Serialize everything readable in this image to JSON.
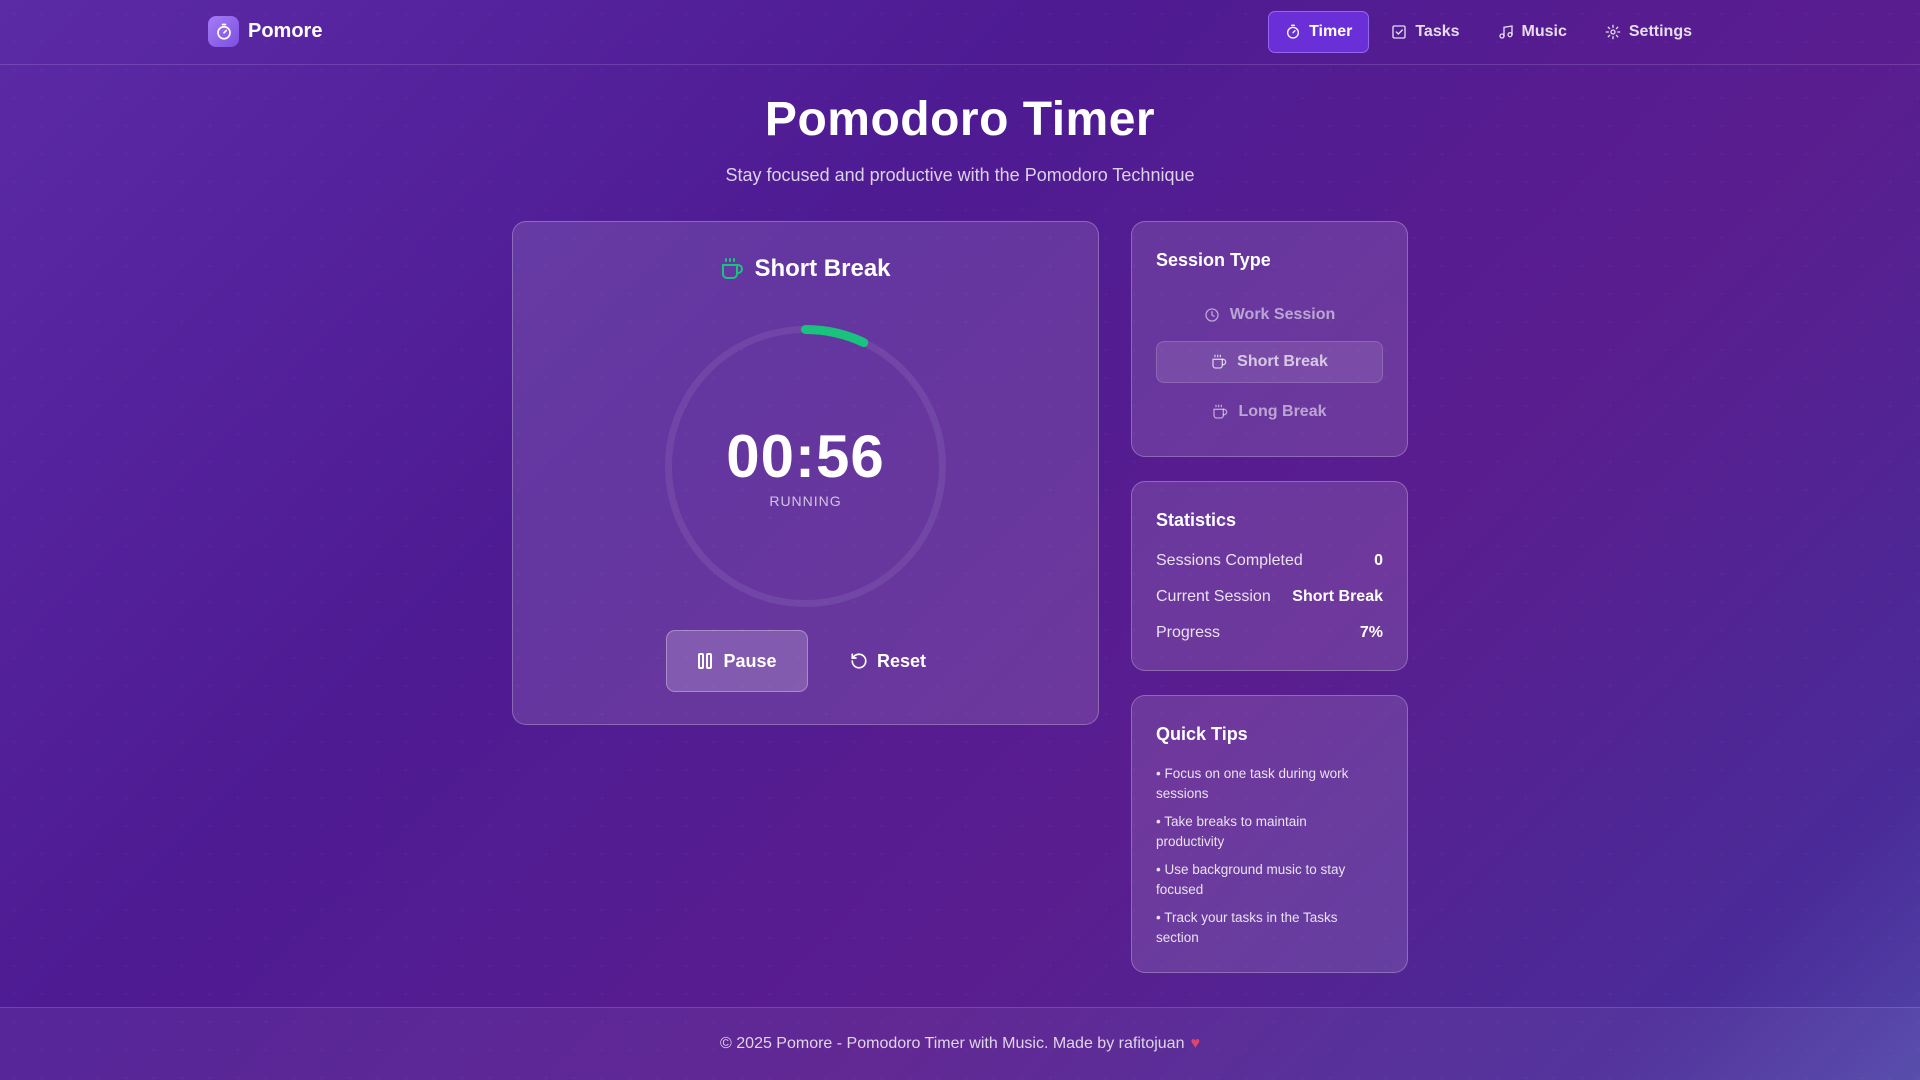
{
  "brand": {
    "name": "Pomore"
  },
  "nav": {
    "items": [
      {
        "label": "Timer",
        "icon": "timer-icon",
        "active": true
      },
      {
        "label": "Tasks",
        "icon": "checkbox-icon",
        "active": false
      },
      {
        "label": "Music",
        "icon": "music-icon",
        "active": false
      },
      {
        "label": "Settings",
        "icon": "gear-icon",
        "active": false
      }
    ]
  },
  "hero": {
    "title": "Pomodoro Timer",
    "subtitle": "Stay focused and productive with the Pomodoro Technique"
  },
  "timer": {
    "session_label": "Short Break",
    "time": "00:56",
    "status": "RUNNING",
    "progress_fraction": 0.07,
    "progress_color": "#19c37d",
    "pause_label": "Pause",
    "reset_label": "Reset"
  },
  "session_type": {
    "title": "Session Type",
    "options": [
      {
        "label": "Work Session",
        "icon": "clock-icon",
        "active": false
      },
      {
        "label": "Short Break",
        "icon": "coffee-icon",
        "active": true
      },
      {
        "label": "Long Break",
        "icon": "coffee-icon",
        "active": false
      }
    ]
  },
  "statistics": {
    "title": "Statistics",
    "rows": [
      {
        "label": "Sessions Completed",
        "value": "0"
      },
      {
        "label": "Current Session",
        "value": "Short Break"
      },
      {
        "label": "Progress",
        "value": "7%"
      }
    ]
  },
  "tips": {
    "title": "Quick Tips",
    "items": [
      "• Focus on one task during work sessions",
      "• Take breaks to maintain productivity",
      "• Use background music to stay focused",
      "• Track your tasks in the Tasks section"
    ]
  },
  "footer": {
    "text": "© 2025 Pomore - Pomodoro Timer with Music. Made by rafitojuan",
    "heart": "♥"
  }
}
